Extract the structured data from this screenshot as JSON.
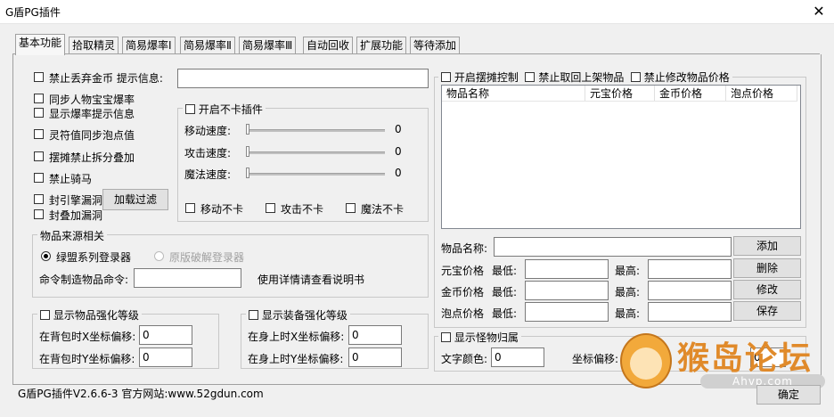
{
  "window": {
    "title": "G盾PG插件",
    "close_icon": "close-icon"
  },
  "tabs": [
    "基本功能",
    "拾取精灵",
    "简易爆率Ⅰ",
    "简易爆率Ⅱ",
    "简易爆率Ⅲ",
    "自动回收",
    "扩展功能",
    "等待添加"
  ],
  "left": {
    "ban_drop_gold": "禁止丢弃金币 提示信息:",
    "sync_drop": "同步人物宝宝爆率",
    "show_drop_info": "显示爆率提示信息",
    "sync_talisman": "灵符值同步泡点值",
    "ban_split": "摆摊禁止拆分叠加",
    "ban_ride": "禁止骑马",
    "seal_engine": "封引擎漏洞",
    "seal_stack": "封叠加漏洞",
    "load_filter": "加载过滤"
  },
  "nolag": {
    "title": "开启不卡插件",
    "move_speed": "移动速度:",
    "attack_speed": "攻击速度:",
    "magic_speed": "魔法速度:",
    "move_value": "0",
    "attack_value": "0",
    "magic_value": "0",
    "move_nolag": "移动不卡",
    "attack_nolag": "攻击不卡",
    "magic_nolag": "魔法不卡"
  },
  "source": {
    "title": "物品来源相关",
    "radio_green": "绿盟系列登录器",
    "radio_orig": "原版破解登录器",
    "cmd_label": "命令制造物品命令:",
    "cmd_hint": "使用详情请查看说明书"
  },
  "bag_enh": {
    "title": "显示物品强化等级",
    "x_label": "在背包时X坐标偏移:",
    "y_label": "在背包时Y坐标偏移:",
    "x_value": "0",
    "y_value": "0"
  },
  "body_enh": {
    "title": "显示装备强化等级",
    "x_label": "在身上时X坐标偏移:",
    "y_label": "在身上时Y坐标偏移:",
    "x_value": "0",
    "y_value": "0"
  },
  "stall": {
    "open_control": "开启摆摊控制",
    "ban_takeback": "禁止取回上架物品",
    "ban_modify": "禁止修改物品价格",
    "columns": [
      "物品名称",
      "元宝价格",
      "金币价格",
      "泡点价格"
    ],
    "item_name_label": "物品名称:",
    "yb_price": "元宝价格",
    "gold_price": "金币价格",
    "pd_price": "泡点价格",
    "min": "最低:",
    "max": "最高:",
    "add": "添加",
    "delete": "删除",
    "modify": "修改",
    "save": "保存"
  },
  "monster": {
    "title": "显示怪物归属",
    "text_color": "文字颜色:",
    "text_color_value": "0",
    "coord_offset": "坐标偏移:",
    "coord_value": "0"
  },
  "status": "G盾PG插件V2.6.6-3 官方网站:www.52gdun.com",
  "ok": "确定",
  "watermark": {
    "main": "猴岛论坛",
    "sub": "Ahvp.com"
  }
}
